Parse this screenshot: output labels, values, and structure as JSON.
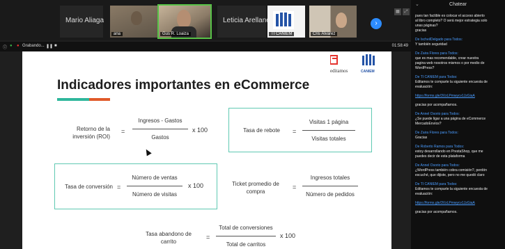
{
  "participants": [
    {
      "name": "Mario Aliaga",
      "tag": "",
      "kind": "name"
    },
    {
      "name": "",
      "tag": "ana",
      "kind": "video"
    },
    {
      "name": "",
      "tag": "Gus R. Loaiza",
      "kind": "face"
    },
    {
      "name": "Leticia Arellano",
      "tag": "",
      "kind": "name"
    },
    {
      "name": "",
      "tag": "TI CANIEM",
      "kind": "logo"
    },
    {
      "name": "",
      "tag": "Cris Álvarez",
      "kind": "video"
    }
  ],
  "recording": {
    "label": "Grabando...",
    "timer": "01:58:49"
  },
  "slide": {
    "brand": {
      "left": "editamos",
      "right": "CANIEM"
    },
    "title": "Indicadores importantes en eCommerce",
    "formulas": [
      {
        "label_l1": "Retorno de la",
        "label_l2": "inversión (ROI)",
        "num": "Ingresos - Gastos",
        "den": "Gastos",
        "mult": "x 100"
      },
      {
        "label_l1": "Tasa de rebote",
        "label_l2": "",
        "num": "Visitas 1 página",
        "den": "Visitas totales",
        "mult": ""
      },
      {
        "label_l1": "Tasa de conversión",
        "label_l2": "",
        "num": "Número de ventas",
        "den": "Número de visitas",
        "mult": "x 100"
      },
      {
        "label_l1": "Ticket promedio de",
        "label_l2": "compra",
        "num": "Ingresos totales",
        "den": "Número de pedidos",
        "mult": ""
      },
      {
        "label_l1": "Tasa abandono de",
        "label_l2": "carrito",
        "num": "Total de conversiones",
        "den": "Total de carritos",
        "mult": "x 100"
      }
    ],
    "equals": "="
  },
  "chat": {
    "title": "Chatear",
    "messages": [
      {
        "from": "",
        "lines": [
          "pues tan factible es colocar el acceso abierto",
          "al libro completo? O será mejor estrategia solo",
          "unas páginas?",
          "gracias"
        ]
      },
      {
        "from": "De IscheilDelgado para Todos:",
        "lines": [
          "Y también seguridad"
        ]
      },
      {
        "from": "De Zaira Flores para Todos:",
        "lines": [
          "que es mas recomendable, crear nuestra",
          "pagina web nosotros mismos o por medio de",
          "WordPress?"
        ]
      },
      {
        "from": "De TI CANIEM para Todos:",
        "lines": [
          "Editamos te comparte la siguiente encuesta de",
          "evaluación:"
        ]
      },
      {
        "from": "",
        "link": "https://forms.gle/3VzLPmwycv1JzGiaA",
        "lines": []
      },
      {
        "from": "",
        "lines": [
          "gracias por acompañarnos."
        ]
      },
      {
        "from": "De Annel Osorio para Todos:",
        "lines": [
          "¿Se puede ligar a una página de eCommerce",
          "MercadoEnvíos?"
        ]
      },
      {
        "from": "De Zaira Flores para Todos:",
        "lines": [
          "Gracias"
        ]
      },
      {
        "from": "De Roberto Ramos para Todos:",
        "lines": [
          "estoy desarrollando en PrestaShop, que me",
          "puedes decir de esta plataforma"
        ]
      },
      {
        "from": "De Annel Osorio para Todos:",
        "lines": [
          "¿WordPress también cobra comisión?, perdón",
          "escuché, que dijiste, pero no me quedó claro"
        ]
      },
      {
        "from": "De TI CANIEM para Todos:",
        "lines": [
          "Editamos te comparte la siguiente encuesta de",
          "evaluación:"
        ]
      },
      {
        "from": "",
        "link": "https://forms.gle/3VzLPmwycv1JzGiaA",
        "lines": []
      },
      {
        "from": "",
        "lines": [
          "gracias por acompañarnos."
        ]
      }
    ]
  },
  "colors": {
    "accent_teal": "#2fb79c",
    "accent_orange": "#e05a2a",
    "box_border": "#5fc9b2",
    "chat_link": "#4a9cff"
  }
}
